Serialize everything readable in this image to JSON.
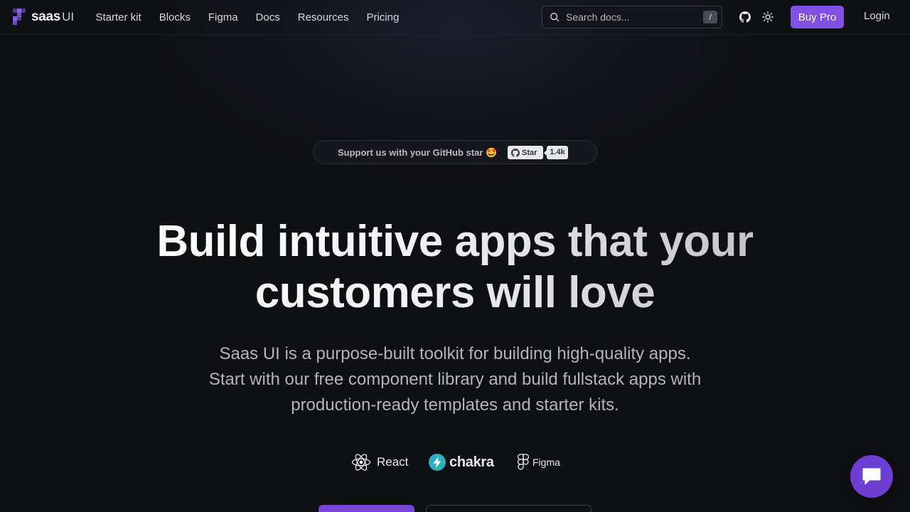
{
  "nav": {
    "logo_text": "saas",
    "logo_suffix": "UI",
    "links": [
      "Starter kit",
      "Blocks",
      "Figma",
      "Docs",
      "Resources",
      "Pricing"
    ],
    "search_placeholder": "Search docs...",
    "search_shortcut": "/",
    "buy_label": "Buy Pro",
    "login_label": "Login"
  },
  "banner": {
    "text": "Support us with your GitHub star 🤩",
    "star_label": "Star",
    "star_count": "1.4k"
  },
  "hero": {
    "title_line1": "Build intuitive apps that your",
    "title_line2": "customers will love",
    "subtitle_line1": "Saas UI is a purpose-built toolkit for building high-quality apps.",
    "subtitle_line2": "Start with our free component library and build fullstack apps with",
    "subtitle_line3": "production-ready templates and starter kits."
  },
  "tech": {
    "react": "React",
    "chakra": "chakra",
    "figma": "Figma"
  },
  "colors": {
    "accent": "#8152e0",
    "background": "#0f1013"
  }
}
